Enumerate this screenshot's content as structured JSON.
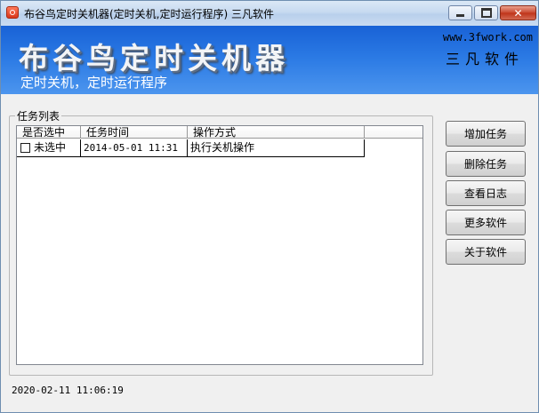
{
  "window": {
    "title": "布谷鸟定时关机器(定时关机,定时运行程序) 三凡软件",
    "close_label": "✕"
  },
  "banner": {
    "title": "布谷鸟定时关机器",
    "subtitle": "定时关机，定时运行程序",
    "website": "www.3fwork.com",
    "brand": "三凡软件"
  },
  "task_group": {
    "label": "任务列表",
    "columns": [
      "是否选中",
      "任务时间",
      "操作方式",
      ""
    ],
    "rows": [
      {
        "selected_label": "未选中",
        "time": "2014-05-01 11:31",
        "action": "执行关机操作"
      }
    ]
  },
  "buttons": {
    "add_task": "增加任务",
    "delete_task": "删除任务",
    "view_log": "查看日志",
    "more_software": "更多软件",
    "about": "关于软件"
  },
  "status": {
    "datetime": "2020-02-11 11:06:19"
  }
}
